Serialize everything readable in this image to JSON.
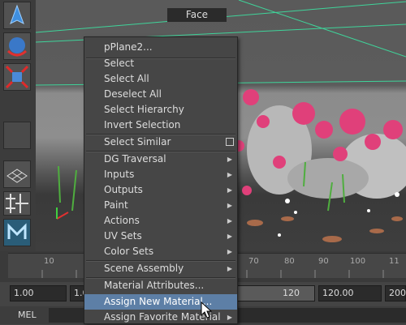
{
  "viewport": {
    "face_label": "Face"
  },
  "timeline": {
    "ticks": [
      "10",
      "70",
      "80",
      "90",
      "100",
      "11"
    ]
  },
  "range": {
    "start_field": "1.00",
    "start2_field": "1.0",
    "slider_end": "120",
    "end_field": "120.00",
    "end2_field": "200"
  },
  "command_line": {
    "label": "MEL"
  },
  "menu": {
    "title": "pPlane2...",
    "items": {
      "select": "Select",
      "select_all": "Select All",
      "deselect_all": "Deselect All",
      "select_hierarchy": "Select Hierarchy",
      "invert_selection": "Invert Selection",
      "select_similar": "Select Similar",
      "dg_traversal": "DG Traversal",
      "inputs": "Inputs",
      "outputs": "Outputs",
      "paint": "Paint",
      "actions": "Actions",
      "uv_sets": "UV Sets",
      "color_sets": "Color Sets",
      "scene_assembly": "Scene Assembly",
      "material_attributes": "Material Attributes...",
      "assign_new_material": "Assign New Material...",
      "assign_favorite_material": "Assign Favorite Material"
    }
  }
}
